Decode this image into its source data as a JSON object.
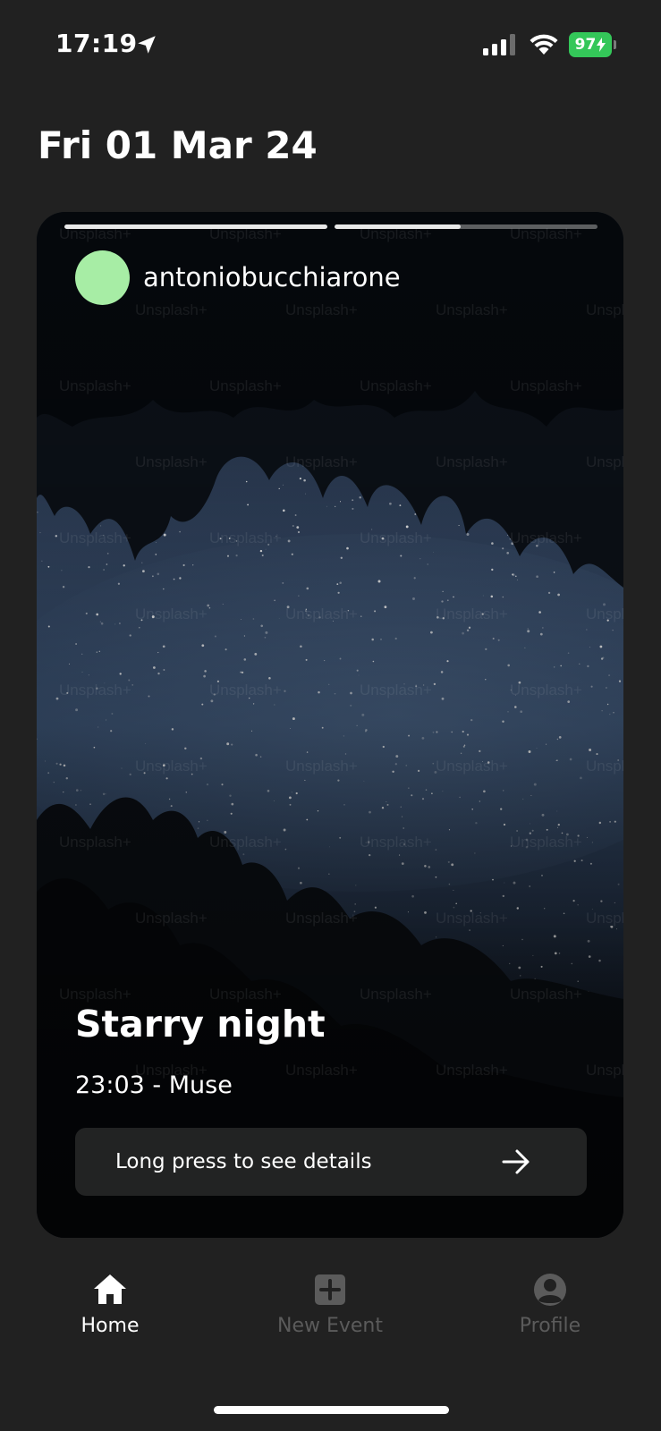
{
  "status_bar": {
    "time": "17:19",
    "battery_level": "97",
    "battery_color": "#34c759"
  },
  "header": {
    "date": "Fri 01 Mar 24"
  },
  "story": {
    "progress": [
      1.0,
      0.48
    ],
    "username": "antoniobucchiarone",
    "avatar_color": "#a7eda5",
    "event_title": "Starry night",
    "event_subtitle": "23:03 - Muse",
    "details_label": "Long press to see details",
    "watermark": "Unsplash+"
  },
  "tab_bar": {
    "tabs": [
      {
        "label": "Home",
        "icon": "home-icon",
        "active": true
      },
      {
        "label": "New Event",
        "icon": "plus-square-icon",
        "active": false
      },
      {
        "label": "Profile",
        "icon": "person-circle-icon",
        "active": false
      }
    ]
  }
}
